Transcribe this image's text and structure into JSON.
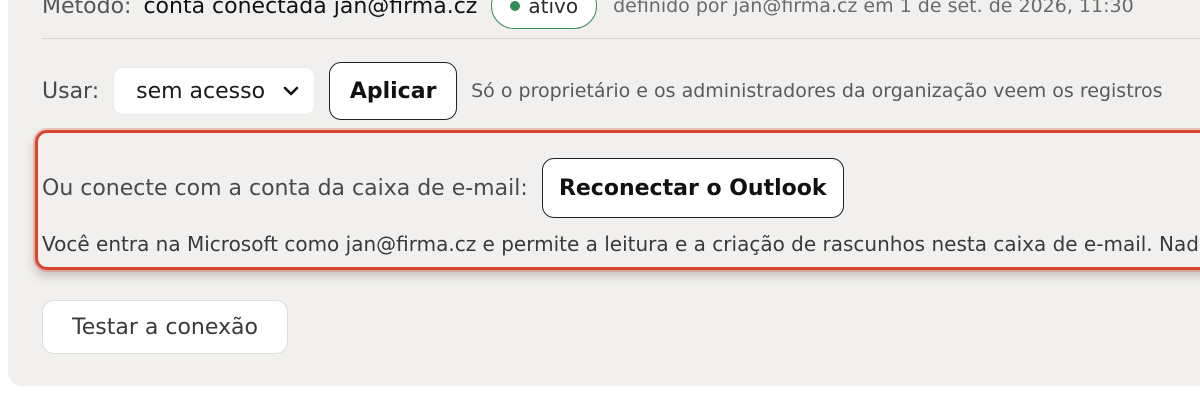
{
  "method": {
    "label": "Método:",
    "value": "conta conectada  jan@firma.cz",
    "status": "ativo",
    "meta": "definido por jan@firma.cz em 1 de set. de 2026, 11:30"
  },
  "use": {
    "label": "Usar:",
    "selected": "sem acesso",
    "apply_label": "Aplicar",
    "note": "Só o proprietário e os administradores da organização veem os registros"
  },
  "connect": {
    "label": "Ou conecte com a conta da caixa de e-mail:",
    "reconnect_label": "Reconectar o Outlook",
    "note": "Você entra na Microsoft como jan@firma.cz e permite a leitura e a criação de rascunhos nesta caixa de e-mail. Nada"
  },
  "test_label": "Testar a conexão",
  "colors": {
    "highlight": "#d9462e",
    "status": "#2f8d55"
  }
}
